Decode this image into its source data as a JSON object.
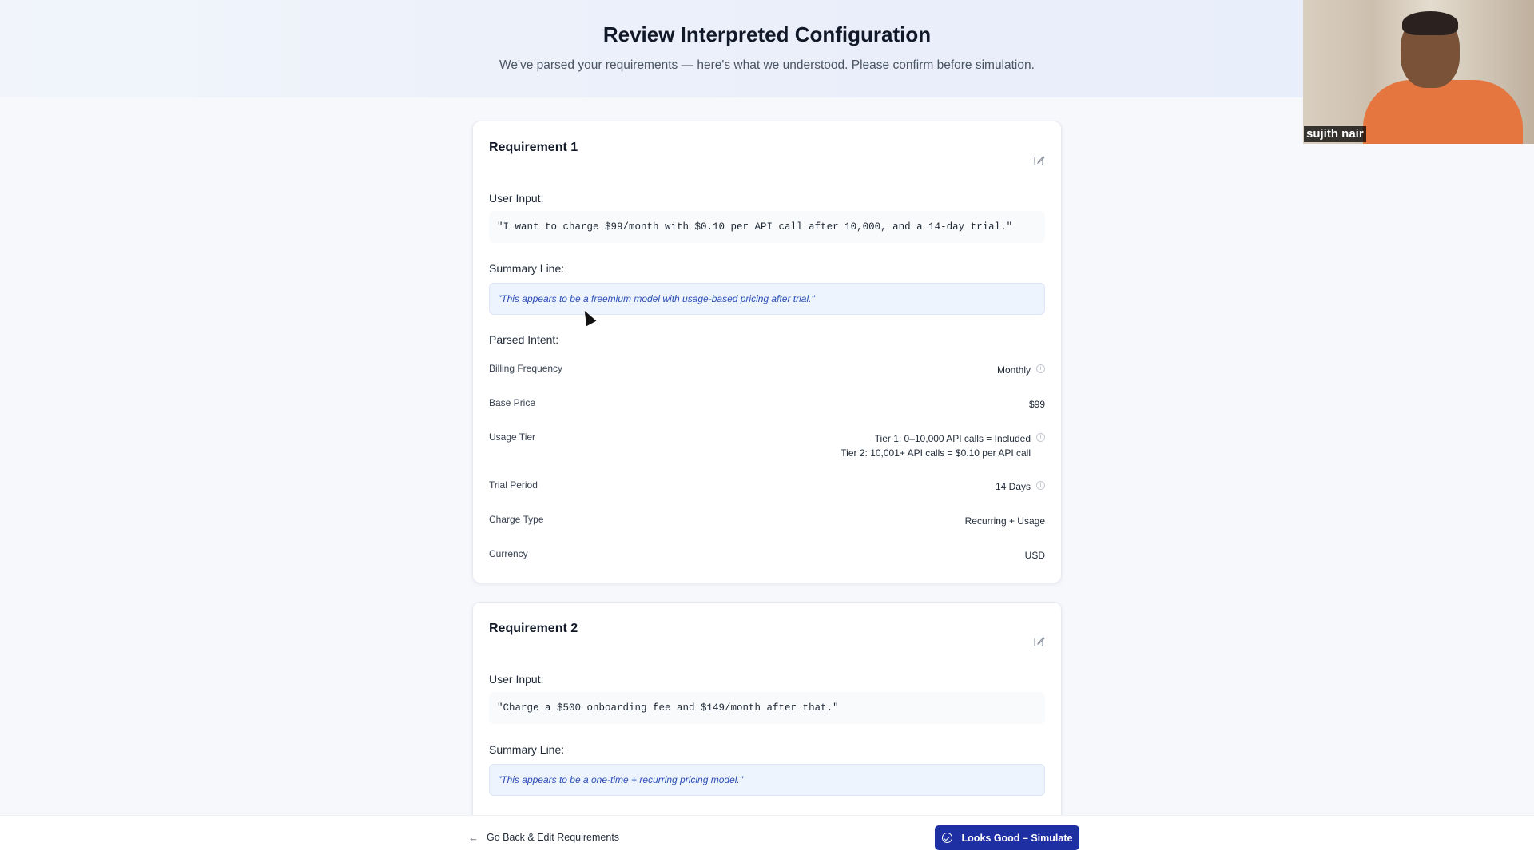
{
  "header": {
    "title": "Review Interpreted Configuration",
    "subtitle": "We've parsed your requirements — here's what we understood. Please confirm before simulation."
  },
  "requirements": [
    {
      "title": "Requirement 1",
      "user_input_label": "User Input:",
      "user_input": "\"I want to charge $99/month with $0.10 per API call after 10,000, and a 14-day trial.\"",
      "summary_label": "Summary Line:",
      "summary": "\"This appears to be a freemium model with usage-based pricing after trial.\"",
      "parsed_label": "Parsed Intent:",
      "intents": [
        {
          "key": "Billing Frequency",
          "value": "Monthly",
          "info_icon": "info-icon"
        },
        {
          "key": "Base Price",
          "value": "$99"
        },
        {
          "key": "Usage Tier",
          "value_line1": "Tier 1: 0–10,000 API calls = Included",
          "value_line2": "Tier 2: 10,001+ API calls = $0.10 per API call",
          "info_icon": "info-icon"
        },
        {
          "key": "Trial Period",
          "value": "14 Days",
          "info_icon": "info-icon"
        },
        {
          "key": "Charge Type",
          "value": "Recurring + Usage"
        },
        {
          "key": "Currency",
          "value": "USD"
        }
      ]
    },
    {
      "title": "Requirement 2",
      "user_input_label": "User Input:",
      "user_input": "\"Charge a $500 onboarding fee and $149/month after that.\"",
      "summary_label": "Summary Line:",
      "summary": "\"This appears to be a one-time + recurring pricing model.\""
    }
  ],
  "footer": {
    "back_label": "Go Back & Edit Requirements",
    "simulate_label": "Looks Good – Simulate"
  },
  "video": {
    "participant_name": "sujith nair"
  },
  "colors": {
    "primary_button": "#1e2fa3",
    "summary_bg": "#eef4fd",
    "summary_text": "#2b4fb8"
  }
}
